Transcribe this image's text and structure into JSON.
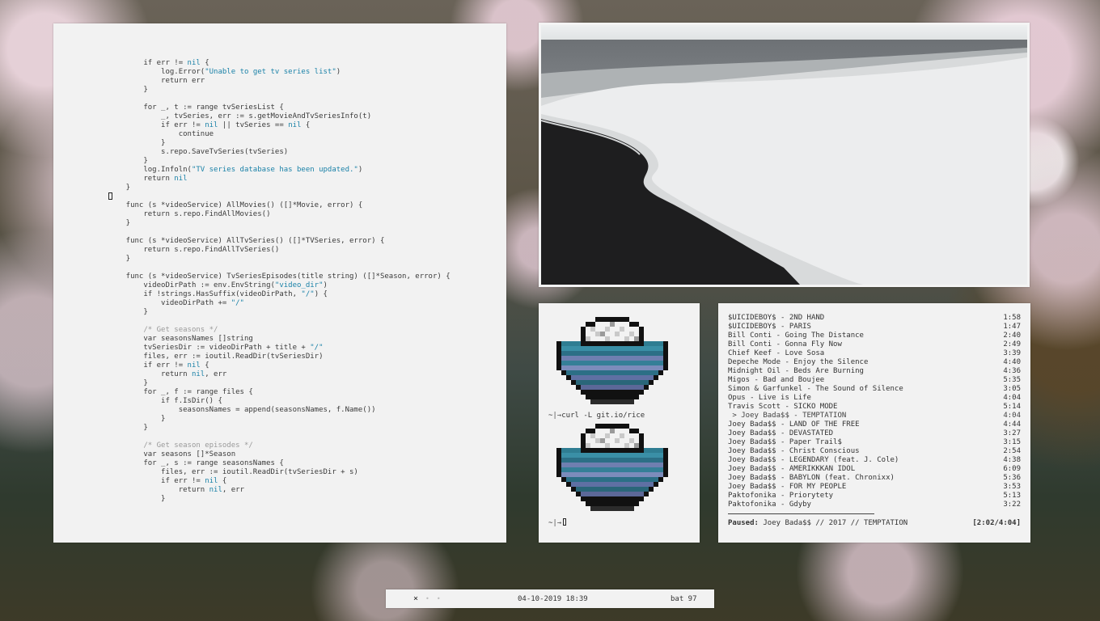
{
  "editor": {
    "lines": [
      [
        [
          "        if err != ",
          ""
        ],
        [
          "nil",
          "kw"
        ],
        [
          " {",
          ""
        ]
      ],
      [
        [
          "            log.Error(",
          ""
        ],
        [
          "\"Unable to get tv series list\"",
          "str"
        ],
        [
          ")",
          ""
        ]
      ],
      [
        [
          "            return err",
          ""
        ]
      ],
      [
        [
          "        }",
          ""
        ]
      ],
      [
        [
          "",
          ""
        ]
      ],
      [
        [
          "        for _, t := range tvSeriesList {",
          ""
        ]
      ],
      [
        [
          "            _, tvSeries, err := s.getMovieAndTvSeriesInfo(t)",
          ""
        ]
      ],
      [
        [
          "            if err != ",
          ""
        ],
        [
          "nil",
          "kw"
        ],
        [
          " || tvSeries == ",
          ""
        ],
        [
          "nil",
          "kw"
        ],
        [
          " {",
          ""
        ]
      ],
      [
        [
          "                continue",
          ""
        ]
      ],
      [
        [
          "            }",
          ""
        ]
      ],
      [
        [
          "            s.repo.SaveTvSeries(tvSeries)",
          ""
        ]
      ],
      [
        [
          "        }",
          ""
        ]
      ],
      [
        [
          "        log.Infoln(",
          ""
        ],
        [
          "\"TV series database has been updated.\"",
          "str"
        ],
        [
          ")",
          ""
        ]
      ],
      [
        [
          "        return ",
          ""
        ],
        [
          "nil",
          "kw"
        ]
      ],
      [
        [
          "    }",
          ""
        ]
      ],
      [
        [
          "__CURSOR__",
          ""
        ]
      ],
      [
        [
          "    func (s *videoService) AllMovies() ([]*Movie, error) {",
          ""
        ]
      ],
      [
        [
          "        return s.repo.FindAllMovies()",
          ""
        ]
      ],
      [
        [
          "    }",
          ""
        ]
      ],
      [
        [
          "",
          ""
        ]
      ],
      [
        [
          "    func (s *videoService) AllTvSeries() ([]*TVSeries, error) {",
          ""
        ]
      ],
      [
        [
          "        return s.repo.FindAllTvSeries()",
          ""
        ]
      ],
      [
        [
          "    }",
          ""
        ]
      ],
      [
        [
          "",
          ""
        ]
      ],
      [
        [
          "    func (s *videoService) TvSeriesEpisodes(title string) ([]*Season, error) {",
          ""
        ]
      ],
      [
        [
          "        videoDirPath := env.EnvString(",
          ""
        ],
        [
          "\"video_dir\"",
          "str"
        ],
        [
          ")",
          ""
        ]
      ],
      [
        [
          "        if !strings.HasSuffix(videoDirPath, ",
          ""
        ],
        [
          "\"/\"",
          "str"
        ],
        [
          ") {",
          ""
        ]
      ],
      [
        [
          "            videoDirPath += ",
          ""
        ],
        [
          "\"/\"",
          "str"
        ]
      ],
      [
        [
          "        }",
          ""
        ]
      ],
      [
        [
          "",
          ""
        ]
      ],
      [
        [
          "        /* Get seasons */",
          "cm"
        ]
      ],
      [
        [
          "        var seasonsNames []string",
          ""
        ]
      ],
      [
        [
          "        tvSeriesDir := videoDirPath + title + ",
          ""
        ],
        [
          "\"/\"",
          "str"
        ]
      ],
      [
        [
          "        files, err := ioutil.ReadDir(tvSeriesDir)",
          ""
        ]
      ],
      [
        [
          "        if err != ",
          ""
        ],
        [
          "nil",
          "kw"
        ],
        [
          " {",
          ""
        ]
      ],
      [
        [
          "            return ",
          ""
        ],
        [
          "nil",
          "kw"
        ],
        [
          ", err",
          ""
        ]
      ],
      [
        [
          "        }",
          ""
        ]
      ],
      [
        [
          "        for _, f := range files {",
          ""
        ]
      ],
      [
        [
          "            if f.IsDir() {",
          ""
        ]
      ],
      [
        [
          "                seasonsNames = append(seasonsNames, f.Name())",
          ""
        ]
      ],
      [
        [
          "            }",
          ""
        ]
      ],
      [
        [
          "        }",
          ""
        ]
      ],
      [
        [
          "",
          ""
        ]
      ],
      [
        [
          "        /* Get season episodes */",
          "cm"
        ]
      ],
      [
        [
          "        var seasons []*Season",
          ""
        ]
      ],
      [
        [
          "        for _, s := range seasonsNames {",
          ""
        ]
      ],
      [
        [
          "            files, err := ioutil.ReadDir(tvSeriesDir + s)",
          ""
        ]
      ],
      [
        [
          "            if err != ",
          ""
        ],
        [
          "nil",
          "kw"
        ],
        [
          " {",
          ""
        ]
      ],
      [
        [
          "                return ",
          ""
        ],
        [
          "nil",
          "kw"
        ],
        [
          ", err",
          ""
        ]
      ],
      [
        [
          "            }",
          ""
        ]
      ]
    ]
  },
  "terminal": {
    "prompt_user": "~",
    "prompt_arrow": "|→",
    "command": "curl -L git.io/rice"
  },
  "music": {
    "tracks": [
      {
        "title": "$UICIDEBOY$ - 2ND HAND",
        "time": "1:58"
      },
      {
        "title": "$UICIDEBOY$ - PARIS",
        "time": "1:47"
      },
      {
        "title": "Bill Conti - Going The Distance",
        "time": "2:40"
      },
      {
        "title": "Bill Conti - Gonna Fly Now",
        "time": "2:49"
      },
      {
        "title": "Chief Keef - Love Sosa",
        "time": "3:39"
      },
      {
        "title": "Depeche Mode - Enjoy the Silence",
        "time": "4:40"
      },
      {
        "title": "Midnight Oil - Beds Are Burning",
        "time": "4:36"
      },
      {
        "title": "Migos - Bad and Boujee",
        "time": "5:35"
      },
      {
        "title": "Simon & Garfunkel - The Sound of Silence",
        "time": "3:05"
      },
      {
        "title": "Opus - Live is Life",
        "time": "4:04"
      },
      {
        "title": "Travis Scott - SICKO MODE",
        "time": "5:14"
      },
      {
        "title": " > Joey Bada$$ - TEMPTATION",
        "time": "4:04",
        "current": true
      },
      {
        "title": "Joey Bada$$ - LAND OF THE FREE",
        "time": "4:44"
      },
      {
        "title": "Joey Bada$$ - DEVASTATED",
        "time": "3:27"
      },
      {
        "title": "Joey Bada$$ - Paper Trail$",
        "time": "3:15"
      },
      {
        "title": "Joey Bada$$ - Christ Conscious",
        "time": "2:54"
      },
      {
        "title": "Joey Bada$$ - LEGENDARY (feat. J. Cole)",
        "time": "4:38"
      },
      {
        "title": "Joey Bada$$ - AMERIKKKAN IDOL",
        "time": "6:09"
      },
      {
        "title": "Joey Bada$$ - BABYLON (feat. Chronixx)",
        "time": "5:36"
      },
      {
        "title": "Joey Bada$$ - FOR MY PEOPLE",
        "time": "3:53"
      },
      {
        "title": "Paktofonika - Priorytety",
        "time": "5:13"
      },
      {
        "title": "Paktofonika - Gdyby",
        "time": "3:22"
      }
    ],
    "progress_fraction": 0.5,
    "status_label": "Paused:",
    "status_text": "Joey Bada$$ // 2017 // TEMPTATION",
    "position": "[2:02/4:04]"
  },
  "bar": {
    "workspace_active": "×",
    "workspace_inactive": [
      "•",
      "•"
    ],
    "datetime": "04-10-2019 18:39",
    "battery": "bat 97"
  }
}
